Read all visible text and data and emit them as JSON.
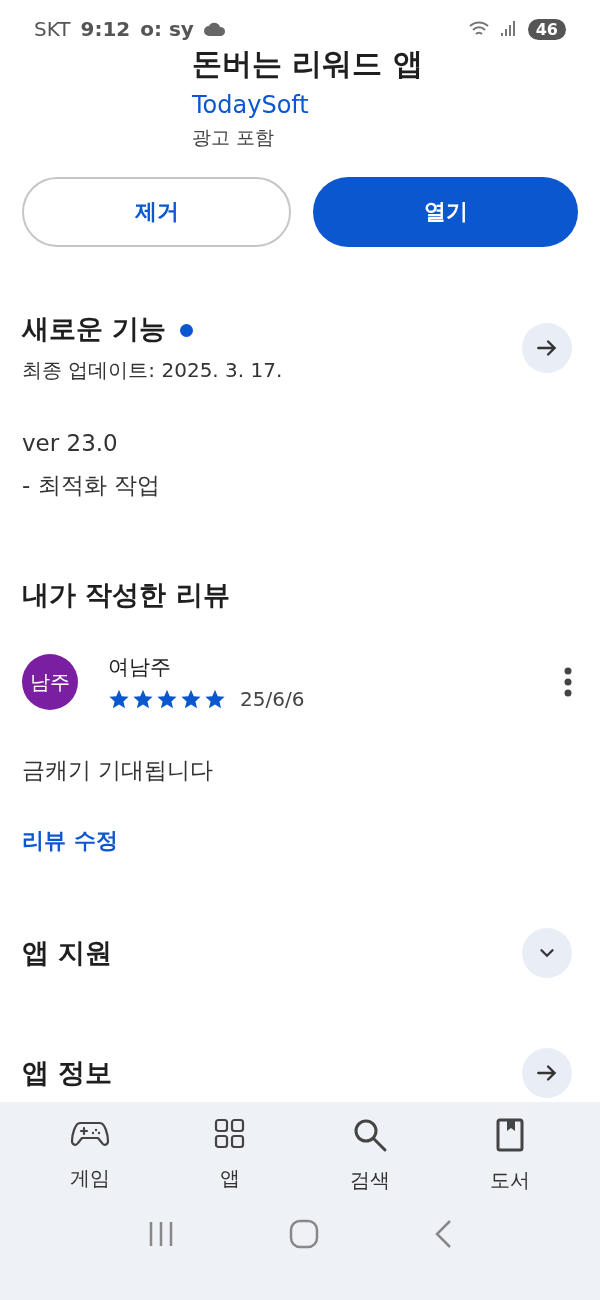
{
  "status_bar": {
    "carrier": "SKT",
    "time": "9:12",
    "indicators": "o: sy",
    "battery": "46"
  },
  "app": {
    "title": "돈버는 리워드 앱",
    "developer": "TodaySoft",
    "ads": "광고 포함"
  },
  "buttons": [
    {
      "label": "제거",
      "kind": "outline"
    },
    {
      "label": "열기",
      "kind": "filled"
    }
  ],
  "whats_new": {
    "title": "새로운 기능",
    "new_dot": true,
    "updated": "최종 업데이트: 2025. 3. 17.",
    "lines": [
      "ver 23.0",
      "- 최적화 작업"
    ]
  },
  "my_review": {
    "title": "내가 작성한 리뷰",
    "avatar": "남주",
    "author": "여남주",
    "stars": 5,
    "date": "25/6/6",
    "text": "금캐기 기대됩니다",
    "edit_link": "리뷰 수정"
  },
  "sections": [
    {
      "title": "앱 지원",
      "kind": "expand"
    },
    {
      "title": "앱 정보",
      "kind": "arrow"
    }
  ],
  "bottom_nav": [
    {
      "label": "게임",
      "kind": "games"
    },
    {
      "label": "앱",
      "kind": "apps"
    },
    {
      "label": "검색",
      "kind": "search"
    },
    {
      "label": "도서",
      "kind": "books"
    }
  ]
}
